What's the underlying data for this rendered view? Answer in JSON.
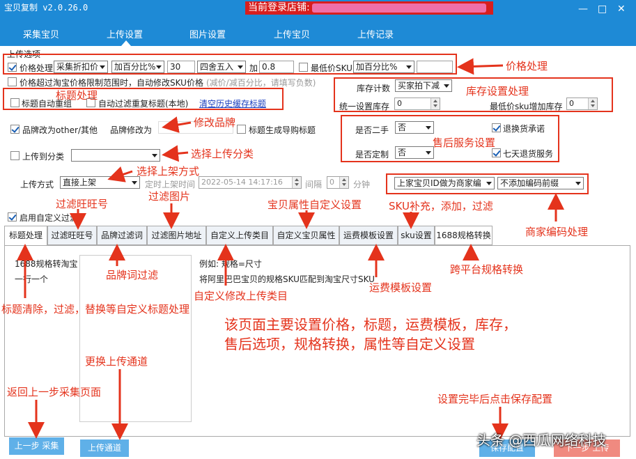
{
  "titlebar": {
    "app_title": "宝贝复制 v2.0.26.0",
    "store_label": "当前登录店铺:",
    "minimize": "—",
    "maximize": "□",
    "close": "✕"
  },
  "nav": {
    "tabs": [
      "采集宝贝",
      "上传设置",
      "图片设置",
      "上传宝贝",
      "上传记录"
    ],
    "active": "上传设置"
  },
  "section_title": "上传选项",
  "price": {
    "checkbox": "价格处理",
    "basis": "采集折扣价",
    "mode": "加百分比%",
    "value": "30",
    "rounding": "四舍五入",
    "add_label": "加",
    "add_value": "0.8",
    "lowest_sku_label": "最低价SKU",
    "lowest_mode": "加百分比%",
    "lowest_value": ""
  },
  "price_limit": {
    "text": "价格超过淘宝价格限制范围时，自动修改SKU价格",
    "hint": "(减价/减百分比，请填写负数)"
  },
  "title_opts": {
    "regroup": "标题自动重组",
    "filter_dup": "自动过滤重复标题(本地)",
    "clear_history": "清空历史缓存标题"
  },
  "stock": {
    "count_label": "库存计数",
    "count_mode": "买家拍下减",
    "uniform_label": "统一设置库存",
    "uniform_value": "0",
    "lowest_label": "最低价sku增加库存",
    "lowest_value": "0"
  },
  "brand": {
    "checkbox": "品牌改为other/其他",
    "change_label": "品牌修改为",
    "guide_title": "标题生成导购标题"
  },
  "after_sale": {
    "second_hand_label": "是否二手",
    "second_hand": "否",
    "custom_label": "是否定制",
    "custom": "否",
    "return_promise": "退换货承诺",
    "seven_day": "七天退货服务"
  },
  "category": {
    "checkbox": "上传到分类",
    "value": ""
  },
  "upload_mode": {
    "label": "上传方式",
    "value": "直接上架",
    "timed_label": "定时上架时间",
    "timed_value": "2022-05-14 14:17:16",
    "interval_label": "间隔",
    "interval_value": "0",
    "minute_label": "分钟"
  },
  "merchant": {
    "id_mode": "上家宝贝ID做为商家编",
    "prefix_mode": "不添加编码前缀"
  },
  "custom_filter": "启用自定义过滤",
  "subtabs": [
    "标题处理",
    "过滤旺旺号",
    "品牌过滤词",
    "过滤图片地址",
    "自定义上传类目",
    "自定义宝贝属性",
    "运费模板设置",
    "sku设置",
    "1688规格转换"
  ],
  "panel": {
    "line1": "1688规格转淘宝",
    "line2": "一行一个",
    "example": "例如: 规格=尺寸",
    "desc": "将阿里巴巴宝贝的规格SKU匹配到淘宝尺寸SKU"
  },
  "buttons": {
    "prev": "上一步 采集",
    "channel": "上传通道",
    "save": "保存配置",
    "next": "下一步 上传"
  },
  "annotations": {
    "price": "价格处理",
    "title": "标题处理",
    "stock": "库存设置处理",
    "brand": "修改品牌",
    "category": "选择上传分类",
    "after_sale": "售后服务设置",
    "upload_mode": "选择上架方式",
    "wangwang": "过滤旺旺号",
    "images": "过滤图片",
    "attrs": "宝贝属性自定义设置",
    "sku": "SKU补充，添加，过滤",
    "merchant": "商家编码处理",
    "brand_filter": "品牌词过滤",
    "cross": "跨平台规格转换",
    "freight": "运费模板设置",
    "custom_cat": "自定义修改上传类目",
    "title_clean": "标题清除，过滤，替换等自定义标题处理",
    "summary1": "该页面主要设置价格，标题，运费模板，库存，",
    "summary2": "售后选项，规格转换，属性等自定义设置",
    "channel": "更换上传通道",
    "back": "返回上一步采集页面",
    "save": "设置完毕后点击保存配置"
  },
  "watermark": "头条 @西瓜网络科技",
  "colors": {
    "bar": "#1e8ad6",
    "annotation": "#e4331c",
    "store": "#d81e1e"
  }
}
